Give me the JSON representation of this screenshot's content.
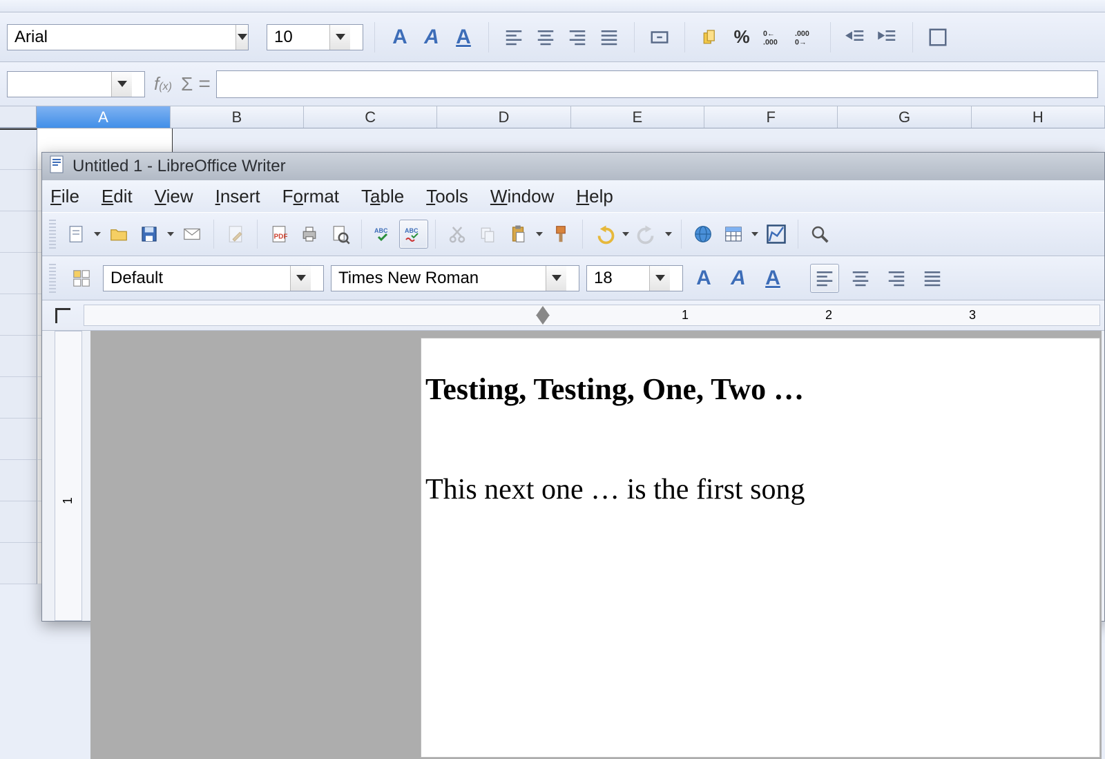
{
  "calc": {
    "font_name": "Arial",
    "font_size": "10",
    "name_box": "",
    "formula": "",
    "columns": [
      "A",
      "B",
      "C",
      "D",
      "E",
      "F",
      "G",
      "H"
    ],
    "selected_col_index": 0
  },
  "writer": {
    "title": "Untitled 1 - LibreOffice Writer",
    "menu": [
      "File",
      "Edit",
      "View",
      "Insert",
      "Format",
      "Table",
      "Tools",
      "Window",
      "Help"
    ],
    "style": "Default",
    "font_name": "Times New Roman",
    "font_size": "18",
    "ruler_numbers": [
      "1",
      "2",
      "3"
    ],
    "vruler_number": "1",
    "heading": "Testing, Testing, One, Two …",
    "body": "This next one … is the first song"
  }
}
